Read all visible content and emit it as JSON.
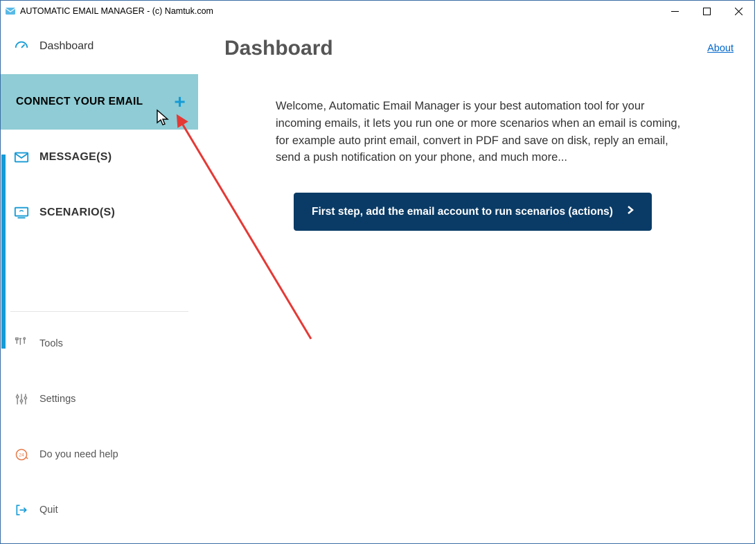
{
  "window": {
    "title": "AUTOMATIC EMAIL MANAGER - (c) Namtuk.com"
  },
  "sidebar": {
    "dashboard": "Dashboard",
    "connect": "CONNECT YOUR EMAIL",
    "plus": "+",
    "messages": "MESSAGE(S)",
    "scenarios": "SCENARIO(S)",
    "tools": "Tools",
    "settings": "Settings",
    "help": "Do you need help",
    "quit": "Quit"
  },
  "content": {
    "title": "Dashboard",
    "about": "About",
    "welcome": "Welcome, Automatic Email Manager is your best automation tool for your incoming emails, it lets you run one or more scenarios when an email is coming, for example auto print email, convert in PDF and save on disk, reply an email, send a push notification on your phone, and much more...",
    "cta": "First step, add the email account to run scenarios (actions)"
  }
}
